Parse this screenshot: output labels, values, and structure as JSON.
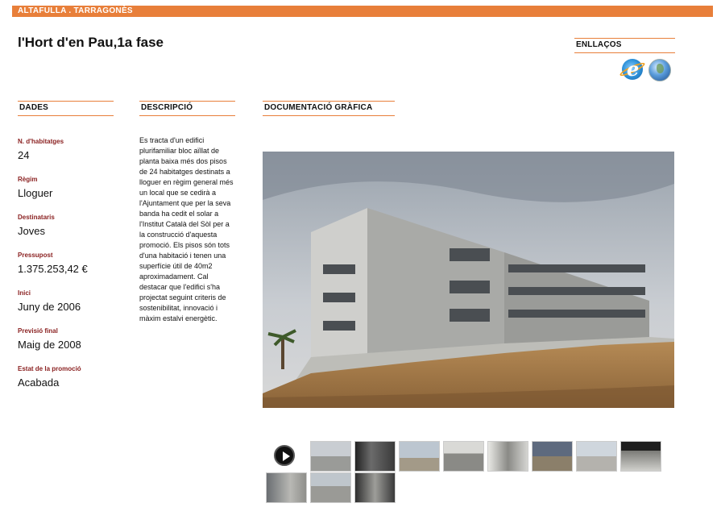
{
  "header": {
    "breadcrumb": "ALTAFULLA . TARRAGONÈS"
  },
  "page": {
    "title": "l'Hort d'en Pau,1a fase"
  },
  "sections": {
    "links": "ENLLAÇOS",
    "data": "DADES",
    "description": "DESCRIPCIÓ",
    "graphics": "DOCUMENTACIÓ GRÀFICA"
  },
  "links": [
    {
      "icon": "internet-explorer-icon"
    },
    {
      "icon": "globe-icon"
    }
  ],
  "fields": [
    {
      "label": "N. d'habitatges",
      "value": "24"
    },
    {
      "label": "Règim",
      "value": "Lloguer"
    },
    {
      "label": "Destinataris",
      "value": "Joves"
    },
    {
      "label": "Pressupost",
      "value": "1.375.253,42 €"
    },
    {
      "label": "Inici",
      "value": "Juny de 2006"
    },
    {
      "label": "Previsió final",
      "value": "Maig de 2008"
    },
    {
      "label": "Estat de la promoció",
      "value": "Acabada"
    }
  ],
  "description": "Es tracta d'un edifici plurifamiliar bloc aïllat de planta baixa més dos pisos de 24 habitatges destinats a lloguer en règim general més un local que se cedirà a l'Ajuntament que per la seva banda ha cedit el solar a l'Institut Català del Sòl per a la construcció d'aquesta promoció. Els pisos són tots d'una habitació i tenen una superfície útil de 40m2 aproximadament. Cal destacar que l'edifici s'ha projectat seguint criteris de sostenibilitat, innovació i màxim estalvi energètic.",
  "gallery": {
    "play_icon": "play-icon",
    "thumbnails": [
      "exterior",
      "interior-kitchen",
      "exterior",
      "interior-room",
      "interior-room",
      "exterior-palm",
      "exterior",
      "interior-room",
      "exterior",
      "exterior",
      "interior-corridor"
    ]
  }
}
